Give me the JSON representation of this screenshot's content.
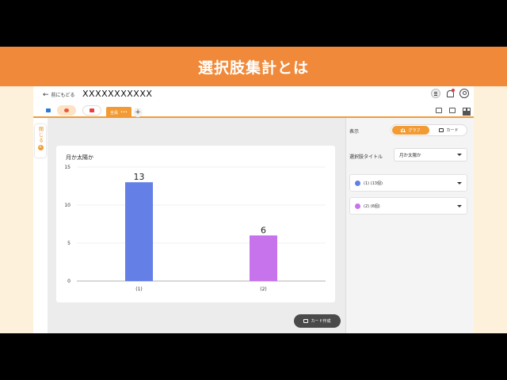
{
  "banner": {
    "title": "選択肢集計とは"
  },
  "header": {
    "back_label": "前にもどる",
    "doc_title": "XXXXXXXXXXX"
  },
  "tabs": {
    "active_label": "全員",
    "active_menu": "•••",
    "add_label": "+"
  },
  "left_panel": {
    "close_label": "閉じる",
    "close_icon": "×"
  },
  "settings": {
    "display_label": "表示",
    "toggle": {
      "graph": "グラフ",
      "card": "カード",
      "selected": "graph"
    },
    "title_label": "選択肢タイトル",
    "title_value": "月か太陽か",
    "options": [
      {
        "label": "(1) (13個)",
        "color": "#6480e6"
      },
      {
        "label": "(2) (6個)",
        "color": "#c673ec"
      }
    ]
  },
  "actions": {
    "card_create": "カード作成"
  },
  "chart_data": {
    "type": "bar",
    "title": "月か太陽か",
    "categories": [
      "(1)",
      "(2)"
    ],
    "values": [
      13,
      6
    ],
    "colors": [
      "#6480e6",
      "#c673ec"
    ],
    "ylim": [
      0,
      15
    ],
    "yticks": [
      0,
      5,
      10,
      15
    ],
    "grid": true
  }
}
